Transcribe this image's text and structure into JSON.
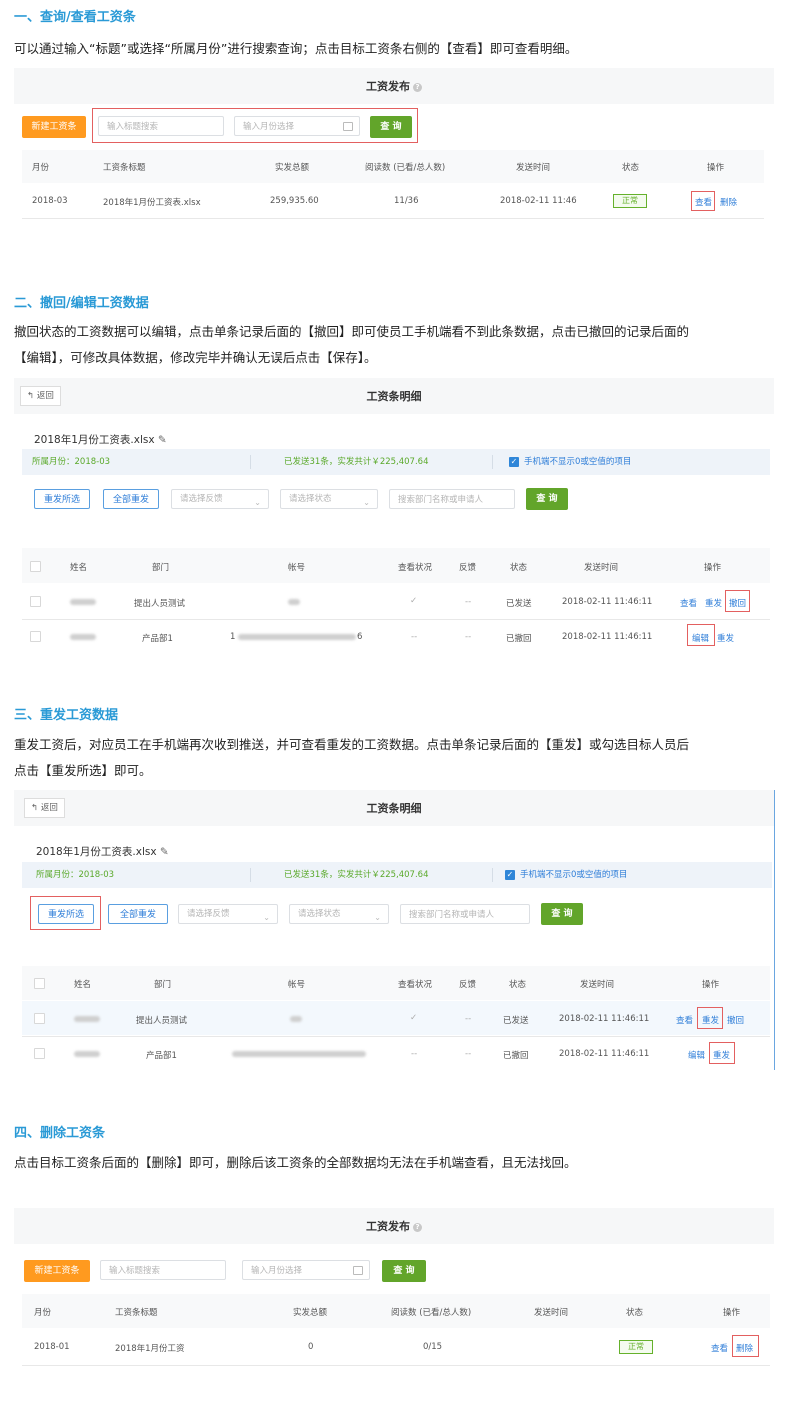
{
  "s1": {
    "title": "一、查询/查看工资条",
    "desc": "可以通过输入“标题”或选择“所属月份”进行搜索查询；点击目标工资条右侧的【查看】即可查看明细。",
    "panel_title": "工资发布",
    "new_btn": "新建工资条",
    "search_placeholder": "输入标题搜索",
    "month_placeholder": "输入月份选择",
    "query_btn": "查 询",
    "headers": [
      "月份",
      "工资条标题",
      "实发总额",
      "阅读数 (已看/总人数)",
      "发送时间",
      "状态",
      "操作"
    ],
    "row": {
      "month": "2018-03",
      "title": "2018年1月份工资表.xlsx",
      "total": "259,935.60",
      "reads": "11/36",
      "time": "2018-02-11 11:46",
      "status": "正常",
      "view": "查看",
      "delete": "删除"
    }
  },
  "s2": {
    "title": "二、撤回/编辑工资数据",
    "desc1": "撤回状态的工资数据可以编辑，点击单条记录后面的【撤回】即可使员工手机端看不到此条数据，点击已撤回的记录后面的",
    "desc2": "【编辑】，可修改具体数据，修改完毕并确认无误后点击【保存】。"
  },
  "detail": {
    "back": "返回",
    "panel_title": "工资条明细",
    "file": "2018年1月份工资表.xlsx",
    "month_info": "所属月份：2018-03",
    "sent_info": "已发送31条，实发共计￥225,407.64",
    "hide_zero": "手机端不显示0或空值的项目",
    "resend_selected": "重发所选",
    "resend_all": "全部重发",
    "feedback_select": "请选择反馈",
    "status_select": "请选择状态",
    "search_placeholder": "搜索部门名称或申请人",
    "query_btn": "查 询",
    "headers": [
      "姓名",
      "部门",
      "帐号",
      "查看状况",
      "反馈",
      "状态",
      "发送时间",
      "操作"
    ],
    "rows": [
      {
        "dept": "提出人员测试",
        "view": "✓",
        "feedback": "--",
        "status": "已发送",
        "time": "2018-02-11 11:46:11",
        "a1": "查看",
        "a2": "重发",
        "a3": "撤回"
      },
      {
        "dept": "产品部1",
        "acct_prefix": "1",
        "acct_suffix": "6",
        "view": "--",
        "feedback": "--",
        "status": "已撤回",
        "time": "2018-02-11 11:46:11",
        "a1": "编辑",
        "a2": "重发"
      }
    ]
  },
  "s3": {
    "title": "三、重发工资数据",
    "desc1": "重发工资后，对应员工在手机端再次收到推送，并可查看重发的工资数据。点击单条记录后面的【重发】或勾选目标人员后",
    "desc2": "点击【重发所选】即可。"
  },
  "s4": {
    "title": "四、删除工资条",
    "desc": "点击目标工资条后面的【删除】即可，删除后该工资条的全部数据均无法在手机端查看，且无法找回。",
    "row": {
      "month": "2018-01",
      "title": "2018年1月份工资",
      "total": "0",
      "reads": "0/15",
      "time": "",
      "status": "正常",
      "view": "查看",
      "delete": "删除"
    }
  },
  "colors": {
    "accent": "#2a9ad6",
    "orange": "#ff9a1f",
    "green": "#62a52a",
    "link": "#2f7ed8",
    "highlight": "#e36060"
  }
}
